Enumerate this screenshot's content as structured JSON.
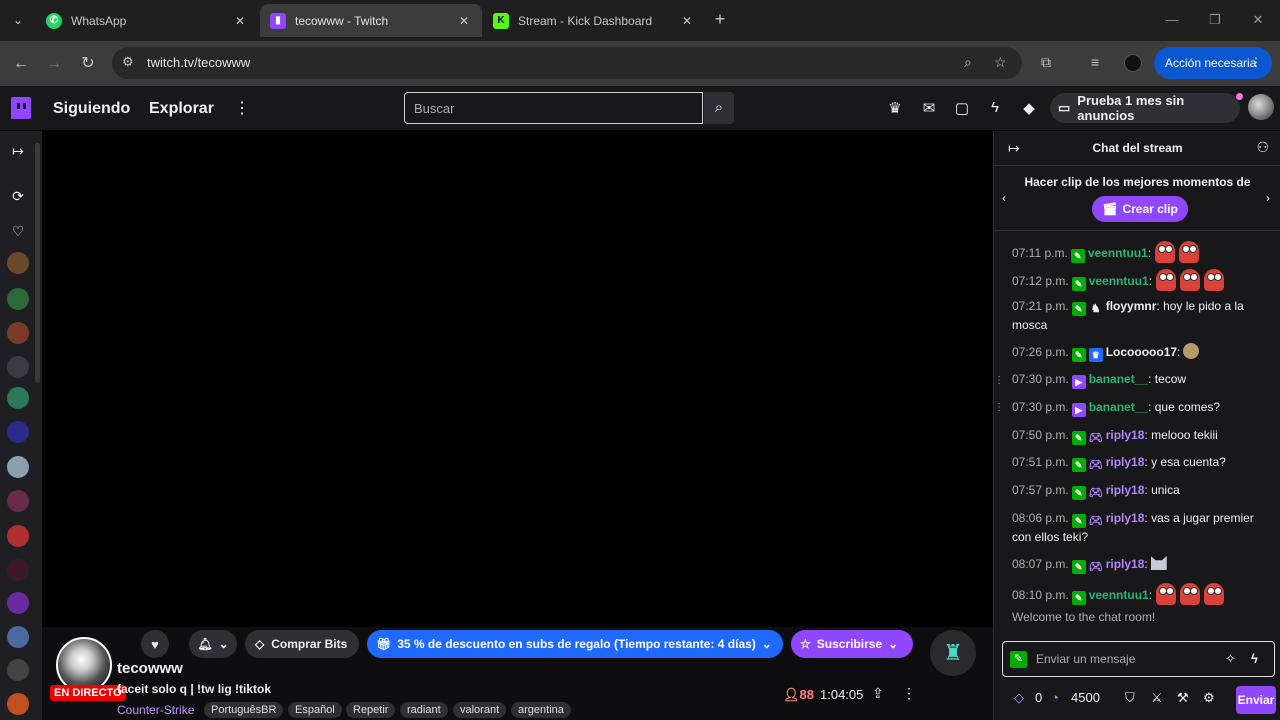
{
  "browser": {
    "tabs": [
      {
        "title": "WhatsApp",
        "icon": "whatsapp-icon",
        "color": "#25d366"
      },
      {
        "title": "tecowww - Twitch",
        "icon": "twitch-icon",
        "color": "#9147ff"
      },
      {
        "title": "Stream - Kick Dashboard",
        "icon": "kick-icon",
        "color": "#53fc18"
      }
    ],
    "url": "twitch.tv/tecowww",
    "action_label": "Acción necesaria"
  },
  "nav": {
    "following": "Siguiendo",
    "browse": "Explorar",
    "search_placeholder": "Buscar",
    "ad_free": "Prueba 1 mes sin anuncios"
  },
  "channel": {
    "name": "tecowww",
    "live_label": "EN DIRECTO",
    "title": "faceit solo q | !tw lig !tiktok",
    "game": "Counter-Strike",
    "tags": [
      "PortuguêsBR",
      "Español",
      "Repetir",
      "radiant",
      "valorant",
      "argentina"
    ],
    "viewers": "88",
    "uptime": "1:04:05",
    "bits_label": "Comprar Bits",
    "promo_label": "35 % de descuento en subs de regalo (Tiempo restante: 4 días)",
    "subscribe_label": "Suscribirse"
  },
  "chat": {
    "header": "Chat del stream",
    "clip_text": "Hacer clip de los mejores momentos de",
    "clip_button": "Crear clip",
    "messages": [
      {
        "ts": "07:11 p.m.",
        "user": "veenntuu1",
        "text": "",
        "emotes": 2
      },
      {
        "ts": "07:12 p.m.",
        "user": "veenntuu1",
        "text": "",
        "emotes": 3
      },
      {
        "ts": "07:21 p.m.",
        "user": "floyymnr",
        "text": "hoy le pido a la mosca"
      },
      {
        "ts": "07:26 p.m.",
        "user": "Locooooo17",
        "text": ""
      },
      {
        "ts": "07:30 p.m.",
        "user": "bananet__",
        "text": "tecow"
      },
      {
        "ts": "07:30 p.m.",
        "user": "bananet__",
        "text": "que comes?"
      },
      {
        "ts": "07:50 p.m.",
        "user": "riply18",
        "text": "melooo tekiii"
      },
      {
        "ts": "07:51 p.m.",
        "user": "riply18",
        "text": "y esa cuenta?"
      },
      {
        "ts": "07:57 p.m.",
        "user": "riply18",
        "text": "unica"
      },
      {
        "ts": "08:06 p.m.",
        "user": "riply18",
        "text": "vas a jugar premier con ellos teki?"
      },
      {
        "ts": "08:07 p.m.",
        "user": "riply18",
        "text": ""
      },
      {
        "ts": "08:10 p.m.",
        "user": "veenntuu1",
        "text": "",
        "emotes": 3
      }
    ],
    "welcome": "Welcome to the chat room!",
    "input_placeholder": "Enviar un mensaje",
    "bits_count": "0",
    "points": "4500",
    "send_label": "Enviar"
  }
}
